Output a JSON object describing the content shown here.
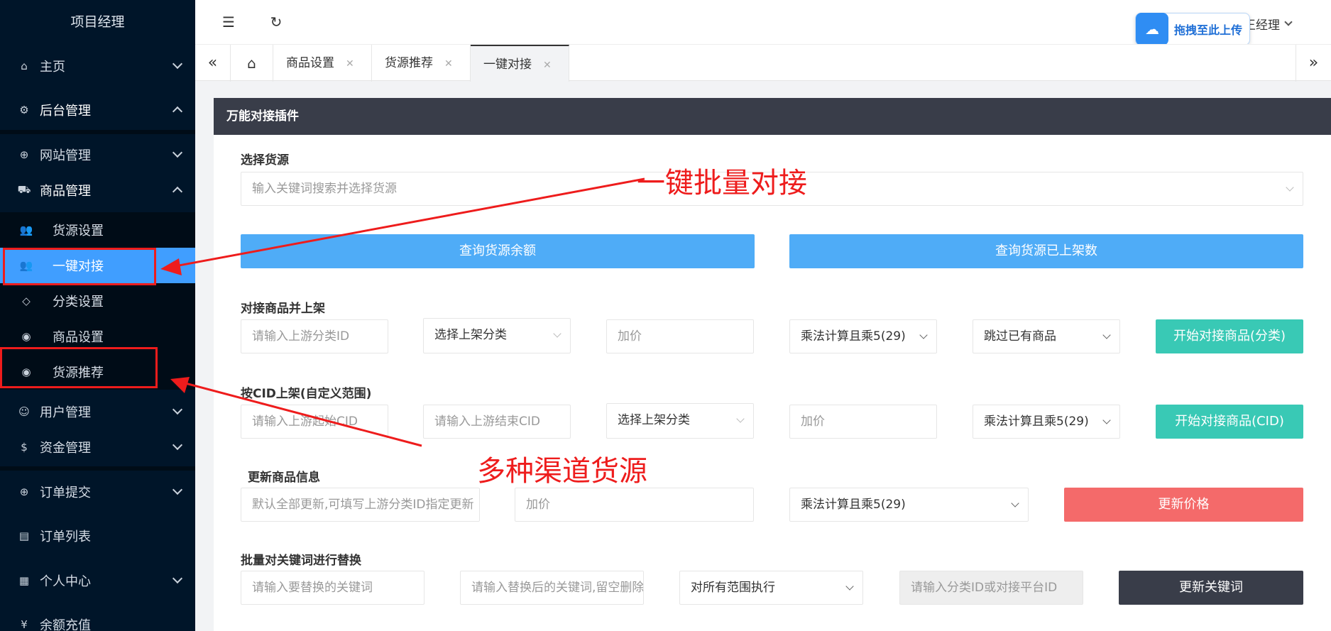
{
  "sidebar": {
    "brand": "项目经理",
    "items": {
      "home": "主页",
      "admin": "后台管理",
      "site": "网站管理",
      "goods": "商品管理",
      "source_settings": "货源设置",
      "one_click": "一键对接",
      "category": "分类设置",
      "goods_settings": "商品设置",
      "source_recommend": "货源推荐",
      "users": "用户管理",
      "funds": "资金管理",
      "order_submit": "订单提交",
      "order_list": "订单列表",
      "personal": "个人中心",
      "recharge": "余额充值"
    }
  },
  "header": {
    "user_name": "王经理",
    "upload_badge": "拖拽至此上传"
  },
  "tabs": [
    "商品设置",
    "货源推荐",
    "一键对接"
  ],
  "panel": {
    "title": "万能对接插件",
    "select_source": {
      "label": "选择货源",
      "placeholder": "输入关键词搜索并选择货源"
    },
    "query_balance": "查询货源余额",
    "query_listed": "查询货源已上架数",
    "sec_connect": {
      "label": "对接商品并上架",
      "category_id_placeholder": "请输入上游分类ID",
      "listing_category": "选择上架分类",
      "price_placeholder": "加价",
      "calc_mode": "乘法计算且乘5(29)",
      "skip_mode": "跳过已有商品",
      "button": "开始对接商品(分类)"
    },
    "sec_cid": {
      "label": "按CID上架(自定义范围)",
      "start_placeholder": "请输入上游起始CID",
      "end_placeholder": "请输入上游结束CID",
      "listing_category": "选择上架分类",
      "price_placeholder": "加价",
      "calc_mode": "乘法计算且乘5(29)",
      "button": "开始对接商品(CID)"
    },
    "sec_update": {
      "label": "更新商品信息",
      "default_placeholder": "默认全部更新,可填写上游分类ID指定更新",
      "price_placeholder": "加价",
      "calc_mode": "乘法计算且乘5(29)",
      "button": "更新价格"
    },
    "sec_keyword": {
      "label": "批量对关键词进行替换",
      "find_placeholder": "请输入要替换的关键词",
      "replace_placeholder": "请输入替换后的关键词,留空删除",
      "scope": "对所有范围执行",
      "id_placeholder": "请输入分类ID或对接平台ID",
      "button": "更新关键词"
    }
  },
  "annotations": {
    "batch": "一键批量对接",
    "channels": "多种渠道货源"
  },
  "colors": {
    "sidebar_bg": "#001529",
    "active_blue": "#409eff",
    "button_blue": "#4facf7",
    "button_teal": "#39c9b5",
    "button_red": "#f46a6a",
    "button_dark": "#393d49",
    "annotation_red": "#ee1c1c"
  }
}
